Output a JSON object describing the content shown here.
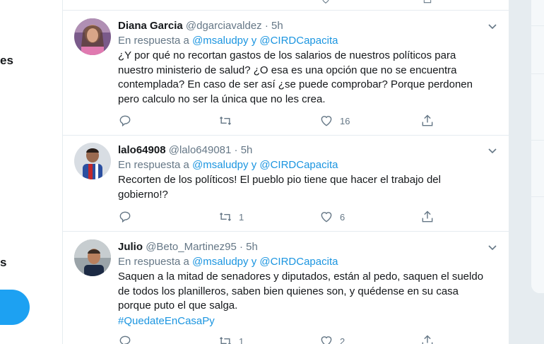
{
  "nav": {
    "fragment_top": "es",
    "fragment_bottom": "s"
  },
  "tweets": [
    {
      "name": "Diana Garcia",
      "handle": "@dgarciavaldez",
      "sep": "·",
      "time": "5h",
      "reply_prefix": "En respuesta a",
      "reply_user1": "@msaludpy",
      "reply_and": "y",
      "reply_user2": "@CIRDCapacita",
      "text": "¿Y por qué no recortan gastos de los salarios de nuestros políticos para nuestro ministerio de salud? ¿O esa es una opción que no se encuentra contemplada? En caso de ser así ¿se puede comprobar? Porque perdonen pero calculo no ser la única que no les crea.",
      "hashtag": "",
      "replies": "",
      "retweets": "",
      "likes": "16"
    },
    {
      "name": "lalo64908",
      "handle": "@lalo649081",
      "sep": "·",
      "time": "5h",
      "reply_prefix": "En respuesta a",
      "reply_user1": "@msaludpy",
      "reply_and": "y",
      "reply_user2": "@CIRDCapacita",
      "text": "Recorten de los políticos! El pueblo pio tiene que hacer el trabajo del gobierno!?",
      "hashtag": "",
      "replies": "",
      "retweets": "1",
      "likes": "6"
    },
    {
      "name": "Julio",
      "handle": "@Beto_Martinez95",
      "sep": "·",
      "time": "5h",
      "reply_prefix": "En respuesta a",
      "reply_user1": "@msaludpy",
      "reply_and": "y",
      "reply_user2": "@CIRDCapacita",
      "text": "Saquen a la mitad de senadores y diputados, están al pedo, saquen el sueldo de todos los planilleros, saben bien quienes son, y quédense en su casa porque puto el que salga.",
      "hashtag": "#QuedateEnCasaPy",
      "replies": "",
      "retweets": "1",
      "likes": "2"
    }
  ],
  "icons": {
    "reply": "reply-icon",
    "retweet": "retweet-icon",
    "like": "heart-icon",
    "share": "share-icon",
    "caret": "chevron-down-icon"
  },
  "colors": {
    "accent": "#1da1f2",
    "link": "#1b95e0",
    "secondary": "#657786",
    "border": "#e6ecf0"
  }
}
